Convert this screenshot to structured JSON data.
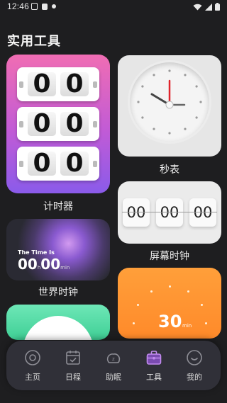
{
  "status_bar": {
    "time": "12:46"
  },
  "page": {
    "title": "实用工具"
  },
  "tools": {
    "timer": {
      "label": "计时器",
      "rows": [
        [
          "00"
        ],
        [
          "00"
        ],
        [
          "00"
        ]
      ],
      "digits": [
        "0",
        "0",
        "0",
        "0",
        "0",
        "0"
      ]
    },
    "stopwatch": {
      "label": "秒表"
    },
    "flip_clock": {
      "label": "屏幕时钟",
      "digits": [
        "00",
        "00",
        "00"
      ]
    },
    "world_clock": {
      "label": "世界时钟",
      "caption": "The Time Is",
      "hours": "00",
      "hours_unit": "h",
      "minutes": "00",
      "minutes_unit": "min"
    },
    "countdown": {
      "value": "30",
      "unit": "min"
    }
  },
  "nav": {
    "items": [
      {
        "label": "主页",
        "icon": "home-circle-icon"
      },
      {
        "label": "日程",
        "icon": "calendar-icon"
      },
      {
        "label": "助眠",
        "icon": "sleep-icon"
      },
      {
        "label": "工具",
        "icon": "toolbox-icon"
      },
      {
        "label": "我的",
        "icon": "profile-icon"
      }
    ],
    "active_index": 3,
    "active_color": "#c38cf0"
  }
}
